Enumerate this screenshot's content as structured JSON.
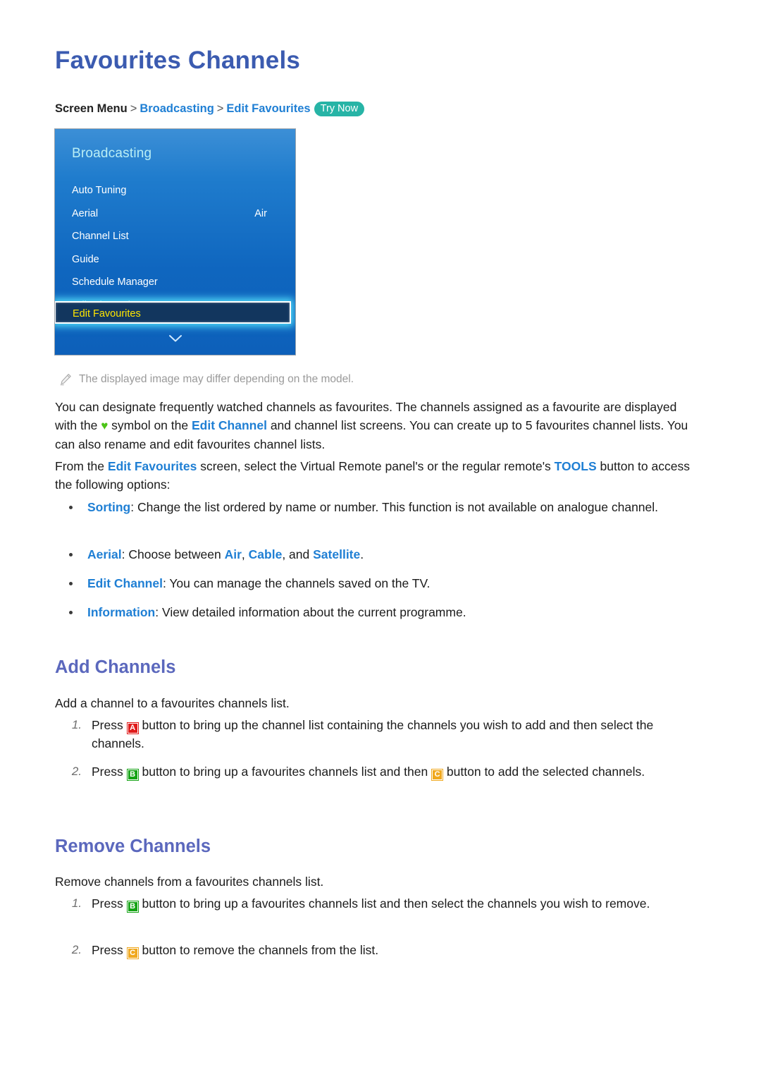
{
  "colors": {
    "title_blue": "#3b5bb0",
    "heading_blue": "#5b68bd",
    "link_blue": "#1f7fd4",
    "try_now_teal": "#27b4a6",
    "heart_green": "#4cc417",
    "key_a_red": "#e01b1b",
    "key_b_green": "#14a314",
    "key_c_yellow": "#f0a81e",
    "menu_highlight_yellow": "#ffe600",
    "menu_glow_cyan": "#4fd8f7"
  },
  "page": {
    "title": "Favourites Channels"
  },
  "breadcrumb": {
    "root": "Screen Menu",
    "separator": ">",
    "level1": "Broadcasting",
    "level2": "Edit Favourites",
    "try_now": "Try Now"
  },
  "tv_menu": {
    "header": "Broadcasting",
    "items": [
      {
        "label": "Auto Tuning",
        "value": ""
      },
      {
        "label": "Aerial",
        "value": "Air"
      },
      {
        "label": "Channel List",
        "value": ""
      },
      {
        "label": "Guide",
        "value": ""
      },
      {
        "label": "Schedule Manager",
        "value": ""
      },
      {
        "label": "Edit Channel",
        "value": ""
      }
    ],
    "selected_item": "Edit Favourites",
    "scroll_icon": "chevron-down-icon"
  },
  "note": {
    "icon": "pencil-icon",
    "text": "The displayed image may differ depending on the model."
  },
  "intro": {
    "p1_a": "You can designate frequently watched channels as favourites. The channels assigned as a favourite are displayed with the",
    "heart": "♥",
    "p1_b": "symbol on the",
    "p1_link": "Edit Channel",
    "p1_c": "and channel list screens. You can create up to 5 favourites channel lists. You can also rename and edit favourites channel lists.",
    "p2_a": "From the",
    "p2_link1": "Edit Favourites",
    "p2_b": "screen, select the Virtual Remote panel's or the regular remote's",
    "p2_link2": "TOOLS",
    "p2_c": "button to access the following options:"
  },
  "options": [
    {
      "term": "Sorting",
      "desc": ": Change the list ordered by name or number. This function is not available on analogue channel."
    },
    {
      "term": "Aerial",
      "desc_a": ": Choose between",
      "opt1": "Air",
      "comma1": ",",
      "opt2": "Cable",
      "desc_b": ", and",
      "opt3": "Satellite",
      "desc_c": "."
    },
    {
      "term": "Edit Channel",
      "desc": ": You can manage the channels saved on the TV."
    },
    {
      "term": "Information",
      "desc": ": View detailed information about the current programme."
    }
  ],
  "add_section": {
    "heading": "Add Channels",
    "lead": "Add a channel to a favourites channels list.",
    "steps": [
      {
        "num": "1.",
        "pre": "Press",
        "key": "A",
        "post": "button to bring up the channel list containing the channels you wish to add and then select the channels."
      },
      {
        "num": "2.",
        "pre": "Press",
        "key": "B",
        "mid": "button to bring up a favourites channels list and then",
        "key2": "C",
        "post": "button to add the selected channels."
      }
    ]
  },
  "remove_section": {
    "heading": "Remove Channels",
    "lead": "Remove channels from a favourites channels list.",
    "steps": [
      {
        "num": "1.",
        "pre": "Press",
        "key": "B",
        "post": "button to bring up a favourites channels list and then select the channels you wish to remove."
      },
      {
        "num": "2.",
        "pre": "Press",
        "key": "C",
        "post": "button to remove the channels from the list."
      }
    ]
  }
}
